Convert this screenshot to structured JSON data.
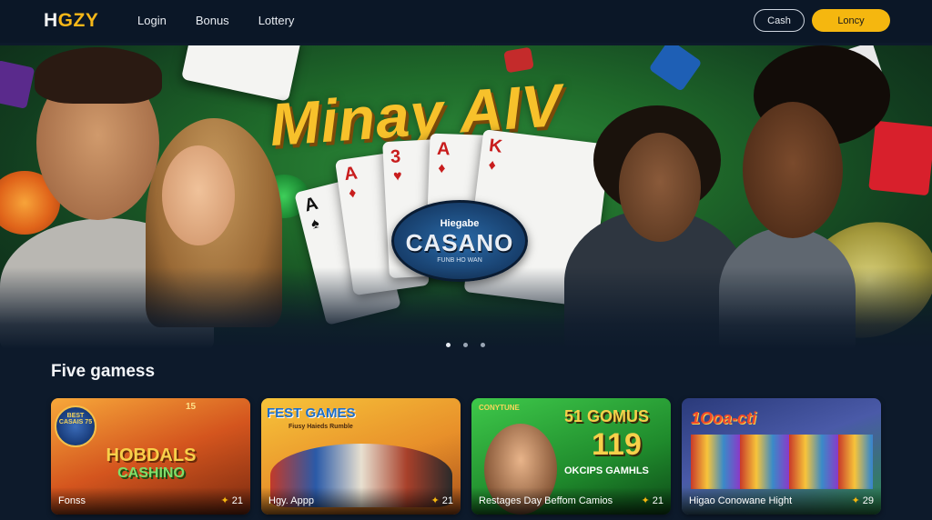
{
  "header": {
    "logo": "HGZY",
    "nav": [
      "Login",
      "Bonus",
      "Lottery"
    ],
    "cash_button": "Cash",
    "lottery_button": "Loncy"
  },
  "hero": {
    "title": "Minay AIV",
    "cards": [
      {
        "rank": "A",
        "suit": "♠"
      },
      {
        "rank": "A",
        "suit": "♦"
      },
      {
        "rank": "3",
        "suit": "♥"
      },
      {
        "rank": "A",
        "suit": "♦"
      },
      {
        "rank": "K",
        "suit": "♦"
      }
    ],
    "badge": {
      "top": "Hiegabe",
      "main": "CASANO",
      "bottom": "FUNB HO WAN"
    },
    "slides": 3,
    "active_slide": 1
  },
  "section": {
    "title": "Five gamess"
  },
  "games": [
    {
      "name": "Fonss",
      "count": "21",
      "art_title": "HOBDALS",
      "art_sub": "CASHINO",
      "art_badge": "BEST CASAIS 75",
      "art_number": "15"
    },
    {
      "name": "Hgy. Appp",
      "count": "21",
      "art_title": "FEST GAMES",
      "art_sub": "Fiusy Haieds Rumble"
    },
    {
      "name": "Restages Day Beffom Camios",
      "count": "21",
      "art_title": "51 GOMUS",
      "art_sub": "OKCIPS GAMHLS",
      "art_number": "119",
      "art_badge": "CONYTUNE"
    },
    {
      "name": "Higao Conowane Hight",
      "count": "29",
      "art_title": "1Ooa-cti"
    }
  ],
  "colors": {
    "accent": "#f5b70f",
    "background": "#0d1a2b",
    "header": "#0b1727"
  }
}
